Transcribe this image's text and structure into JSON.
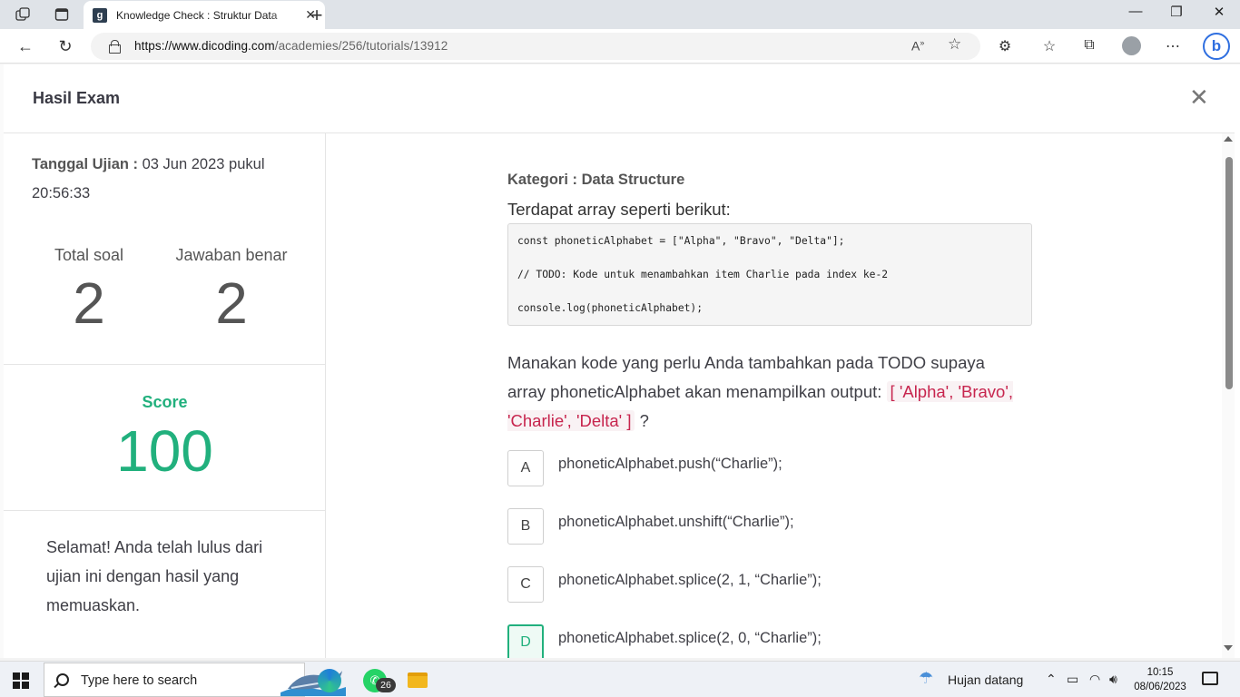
{
  "browser": {
    "tab_title": "Knowledge Check : Struktur Data",
    "url_domain": "https://www.dicoding.com",
    "url_path": "/academies/256/tutorials/13912",
    "favicon_letter": "g"
  },
  "modal": {
    "title": "Hasil Exam"
  },
  "sidebar": {
    "exam_date_label": "Tanggal Ujian :",
    "exam_date_value": "03 Jun 2023 pukul 20:56:33",
    "total_label": "Total soal",
    "total_value": "2",
    "correct_label": "Jawaban benar",
    "correct_value": "2",
    "score_label": "Score",
    "score_value": "100",
    "message": "Selamat! Anda telah lulus dari ujian ini dengan hasil yang memuaskan."
  },
  "question": {
    "category_label": "Kategori : Data Structure",
    "intro": "Terdapat array seperti berikut:",
    "code": [
      "const phoneticAlphabet = [\"Alpha\", \"Bravo\", \"Delta\"];",
      "// TODO: Kode untuk menambahkan item Charlie pada index ke-2",
      "console.log(phoneticAlphabet);"
    ],
    "text_before": "Manakan kode yang perlu Anda tambahkan pada TODO supaya array phoneticAlphabet akan menampilkan output: ",
    "output_code": "[ 'Alpha', 'Bravo', 'Charlie', 'Delta' ]",
    "text_after": " ?",
    "options": [
      {
        "letter": "A",
        "text": "phoneticAlphabet.push(“Charlie”);"
      },
      {
        "letter": "B",
        "text": "phoneticAlphabet.unshift(“Charlie”);"
      },
      {
        "letter": "C",
        "text": "phoneticAlphabet.splice(2, 1, “Charlie”);"
      },
      {
        "letter": "D",
        "text": "phoneticAlphabet.splice(2, 0, “Charlie”);"
      }
    ]
  },
  "taskbar": {
    "search_placeholder": "Type here to search",
    "whatsapp_badge": "26",
    "weather_text": "Hujan datang",
    "time": "10:15",
    "date": "08/06/2023"
  },
  "colors": {
    "accent_green": "#21b07d",
    "code_red": "#c7254e",
    "browser_accent": "#2f6fe0"
  }
}
